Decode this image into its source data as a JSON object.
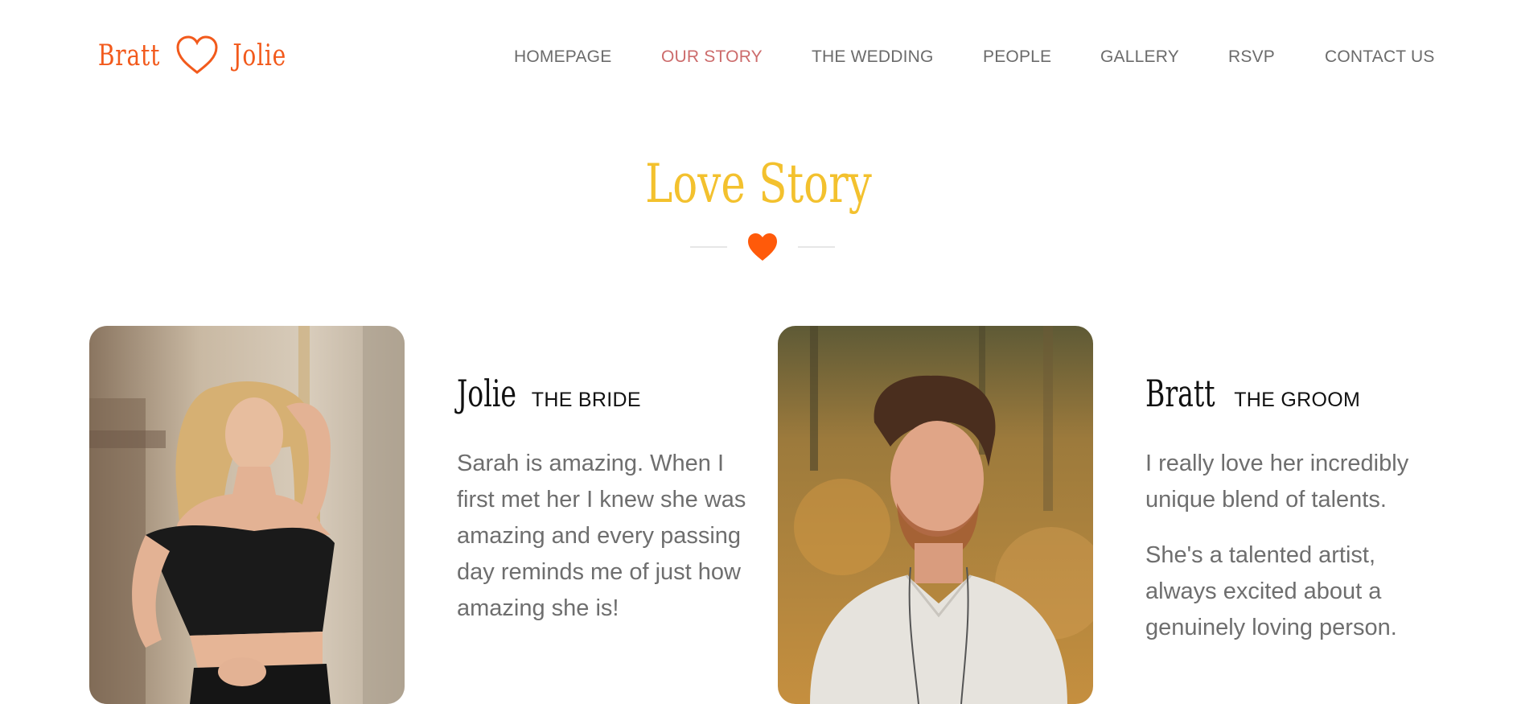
{
  "logo": {
    "left_name": "Bratt",
    "right_name": "Jolie",
    "icon": "heart-outline-icon"
  },
  "nav": {
    "items": [
      {
        "label": "HOMEPAGE"
      },
      {
        "label": "OUR STORY",
        "active": true
      },
      {
        "label": "THE WEDDING"
      },
      {
        "label": "PEOPLE"
      },
      {
        "label": "GALLERY"
      },
      {
        "label": "RSVP"
      },
      {
        "label": "CONTACT US"
      }
    ]
  },
  "section": {
    "title": "Love Story",
    "divider_icon": "heart-icon"
  },
  "bride": {
    "name": "Jolie",
    "role": "THE BRIDE",
    "paragraphs": [
      "Sarah is amazing. When I first met her I knew she was amazing and every passing day reminds me of just how amazing she is!"
    ]
  },
  "groom": {
    "name": "Bratt",
    "role": "THE GROOM",
    "paragraphs": [
      "I really love her incredibly unique blend of talents.",
      "She's a talented artist, always excited about a genuinely loving person."
    ]
  },
  "colors": {
    "logo": "#f25a1c",
    "accent_heart": "#ff5a0a",
    "title": "#f3c12e",
    "nav_text": "#6b6b6b",
    "nav_active": "#cc6b6b",
    "body_text": "#6e6e6e"
  }
}
